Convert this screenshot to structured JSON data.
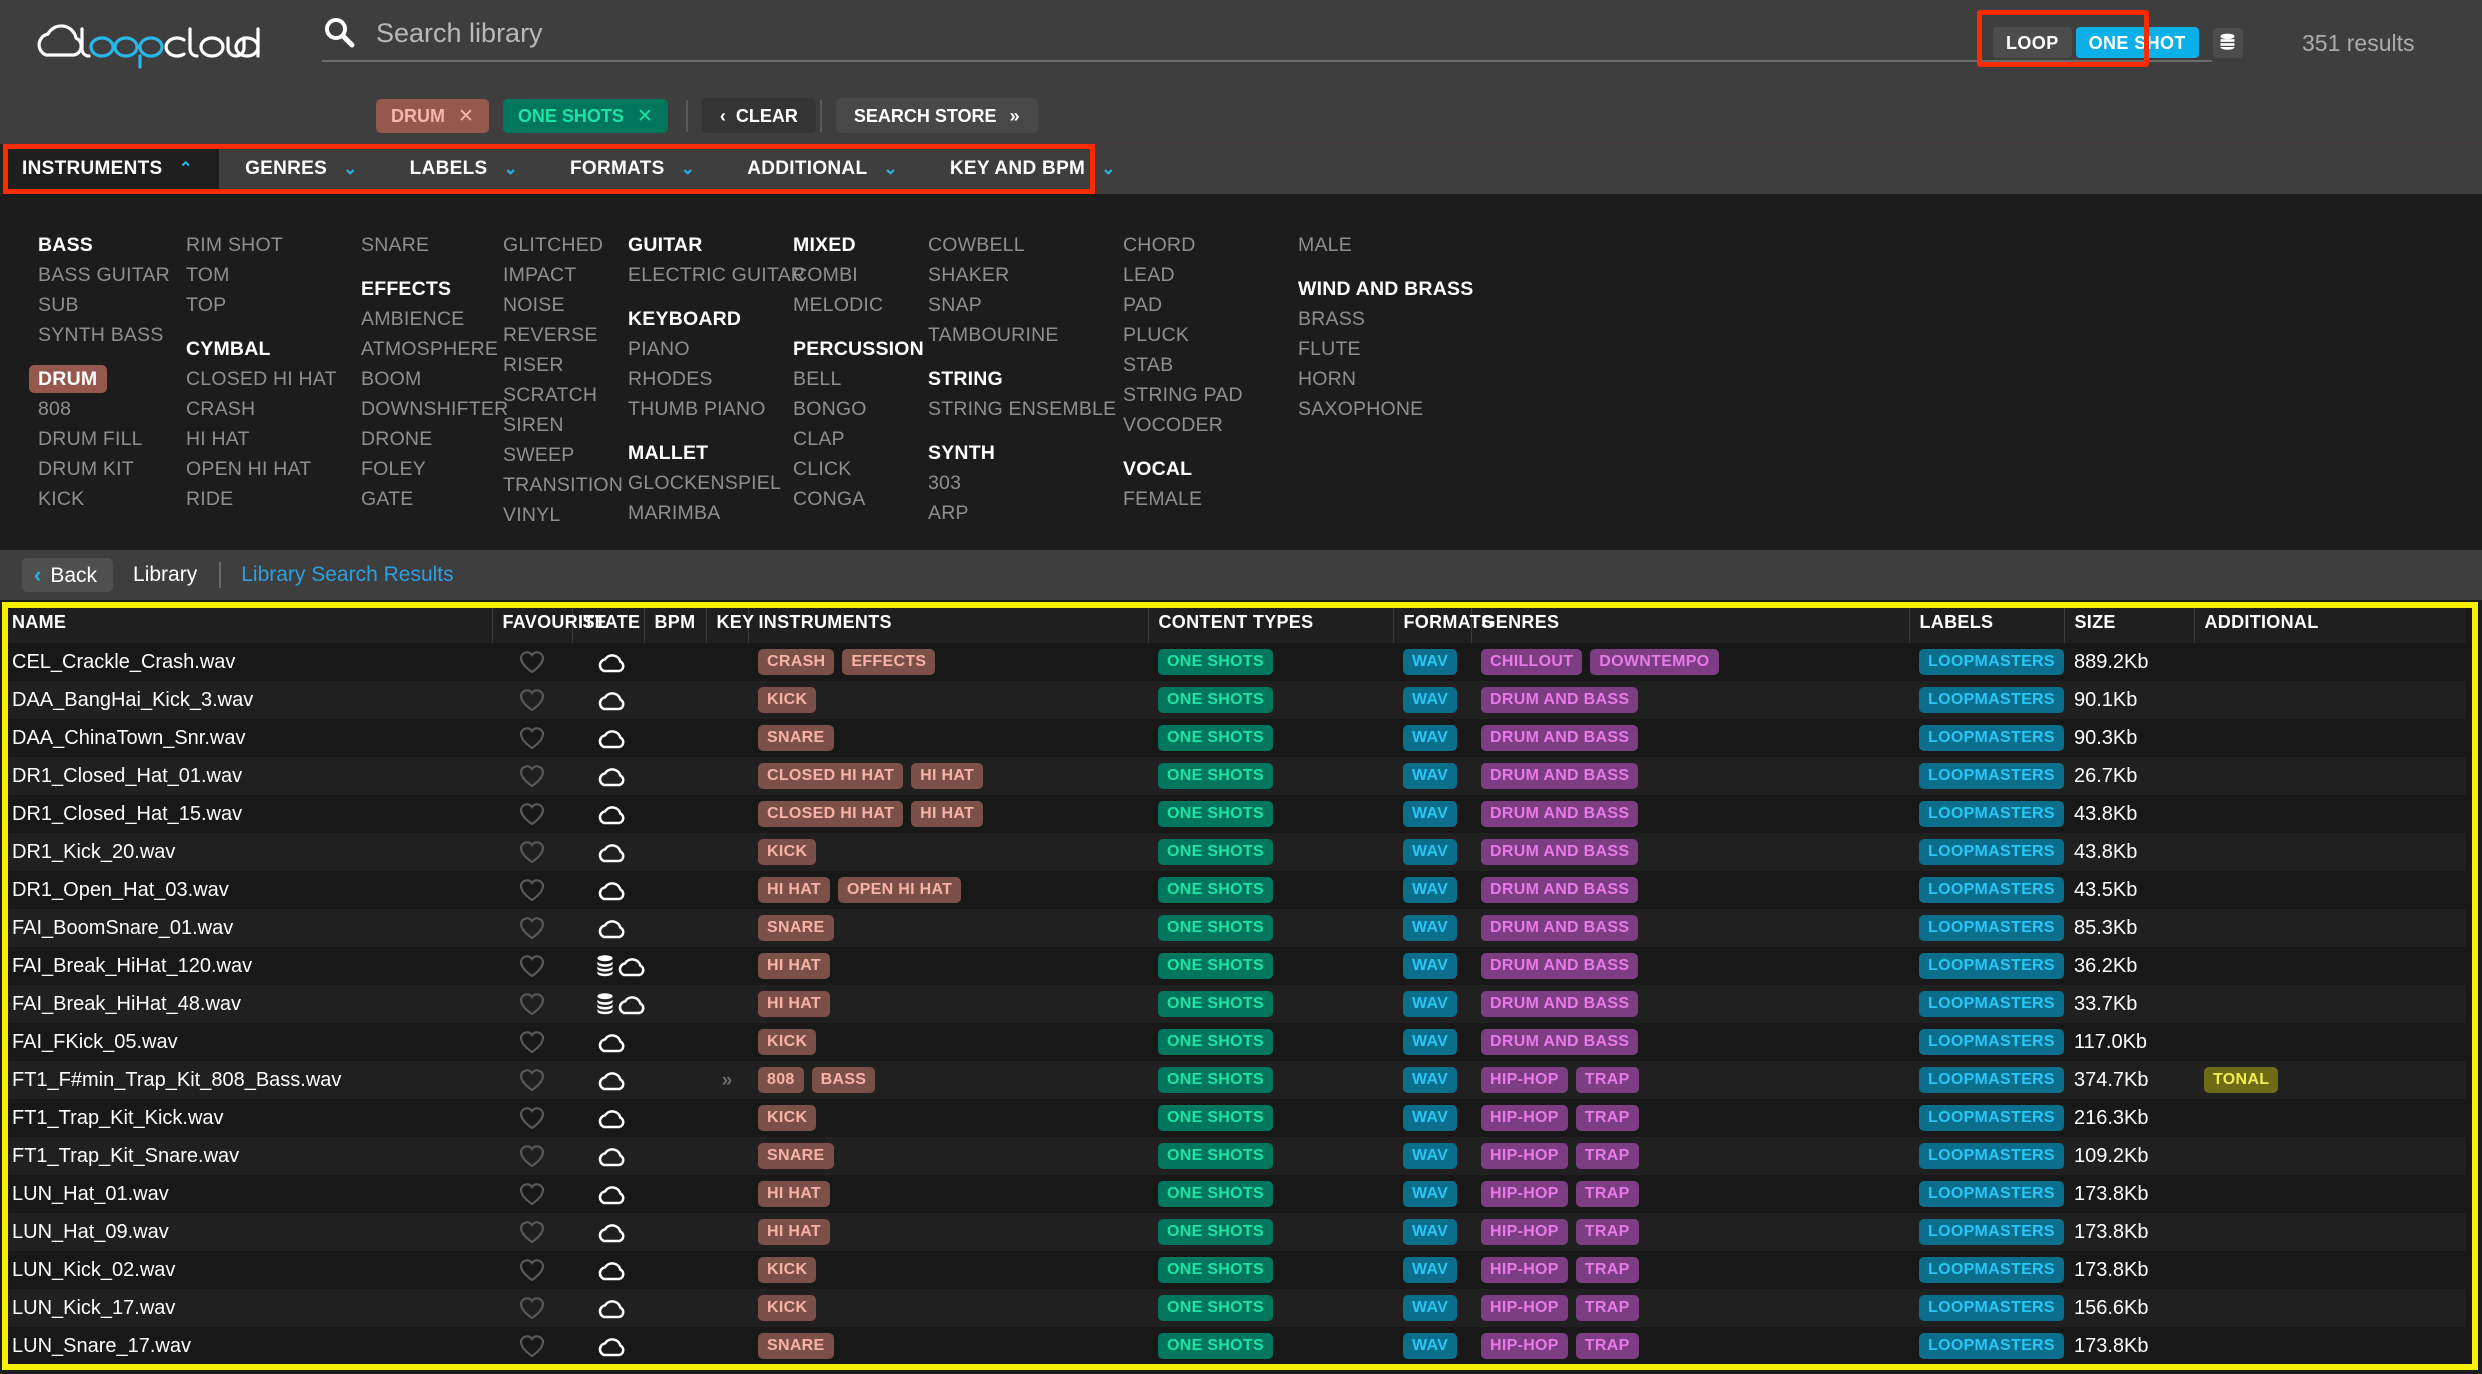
{
  "header": {
    "logo_text": "loopcloud",
    "search_placeholder": "Search library",
    "search_value": "",
    "mode_loop": "LOOP",
    "mode_oneshot": "ONE SHOT",
    "results_count": "351 results",
    "accent_blue": "#0cb0e8",
    "highlight_red": "#ff2b00",
    "highlight_yellow": "#f7f000"
  },
  "active_filters": [
    {
      "label": "DRUM",
      "close": "✕",
      "kind": "drum"
    },
    {
      "label": "ONE SHOTS",
      "close": "✕",
      "kind": "oneshots"
    }
  ],
  "filter_actions": {
    "clear_label": "CLEAR",
    "clear_icon": "‹",
    "search_store_label": "SEARCH STORE",
    "search_store_icon": "»"
  },
  "facet_tabs": [
    {
      "label": "INSTRUMENTS",
      "caret": "⌃",
      "active": true
    },
    {
      "label": "GENRES",
      "caret": "⌄",
      "active": false
    },
    {
      "label": "LABELS",
      "caret": "⌄",
      "active": false
    },
    {
      "label": "FORMATS",
      "caret": "⌄",
      "active": false
    },
    {
      "label": "ADDITIONAL",
      "caret": "⌄",
      "active": false
    },
    {
      "label": "KEY AND BPM",
      "caret": "⌄",
      "active": false
    }
  ],
  "facet_columns": [
    {
      "items": [
        {
          "text": "BASS",
          "type": "head"
        },
        {
          "text": "BASS GUITAR",
          "type": "item"
        },
        {
          "text": "SUB",
          "type": "item"
        },
        {
          "text": "SYNTH BASS",
          "type": "item"
        },
        {
          "text": "",
          "type": "spacer"
        },
        {
          "text": "DRUM",
          "type": "selected"
        },
        {
          "text": "808",
          "type": "item"
        },
        {
          "text": "DRUM FILL",
          "type": "item"
        },
        {
          "text": "DRUM KIT",
          "type": "item"
        },
        {
          "text": "KICK",
          "type": "item"
        }
      ]
    },
    {
      "items": [
        {
          "text": "RIM SHOT",
          "type": "item"
        },
        {
          "text": "TOM",
          "type": "item"
        },
        {
          "text": "TOP",
          "type": "item"
        },
        {
          "text": "",
          "type": "spacer"
        },
        {
          "text": "CYMBAL",
          "type": "head"
        },
        {
          "text": "CLOSED HI HAT",
          "type": "item"
        },
        {
          "text": "CRASH",
          "type": "item"
        },
        {
          "text": "HI HAT",
          "type": "item"
        },
        {
          "text": "OPEN HI HAT",
          "type": "item"
        },
        {
          "text": "RIDE",
          "type": "item"
        }
      ]
    },
    {
      "items": [
        {
          "text": "SNARE",
          "type": "item"
        },
        {
          "text": "",
          "type": "spacer"
        },
        {
          "text": "EFFECTS",
          "type": "head"
        },
        {
          "text": "AMBIENCE",
          "type": "item"
        },
        {
          "text": "ATMOSPHERE",
          "type": "item"
        },
        {
          "text": "BOOM",
          "type": "item"
        },
        {
          "text": "DOWNSHIFTER",
          "type": "item"
        },
        {
          "text": "DRONE",
          "type": "item"
        },
        {
          "text": "FOLEY",
          "type": "item"
        },
        {
          "text": "GATE",
          "type": "item"
        }
      ]
    },
    {
      "items": [
        {
          "text": "GLITCHED",
          "type": "item"
        },
        {
          "text": "IMPACT",
          "type": "item"
        },
        {
          "text": "NOISE",
          "type": "item"
        },
        {
          "text": "REVERSE",
          "type": "item"
        },
        {
          "text": "RISER",
          "type": "item"
        },
        {
          "text": "SCRATCH",
          "type": "item"
        },
        {
          "text": "SIREN",
          "type": "item"
        },
        {
          "text": "SWEEP",
          "type": "item"
        },
        {
          "text": "TRANSITION",
          "type": "item"
        },
        {
          "text": "VINYL",
          "type": "item"
        }
      ]
    },
    {
      "items": [
        {
          "text": "GUITAR",
          "type": "head"
        },
        {
          "text": "ELECTRIC GUITAR",
          "type": "item"
        },
        {
          "text": "",
          "type": "spacer"
        },
        {
          "text": "KEYBOARD",
          "type": "head"
        },
        {
          "text": "PIANO",
          "type": "item"
        },
        {
          "text": "RHODES",
          "type": "item"
        },
        {
          "text": "THUMB PIANO",
          "type": "item"
        },
        {
          "text": "",
          "type": "spacer"
        },
        {
          "text": "MALLET",
          "type": "head"
        },
        {
          "text": "GLOCKENSPIEL",
          "type": "item"
        },
        {
          "text": "MARIMBA",
          "type": "item"
        }
      ]
    },
    {
      "items": [
        {
          "text": "MIXED",
          "type": "head"
        },
        {
          "text": "COMBI",
          "type": "item"
        },
        {
          "text": "MELODIC",
          "type": "item"
        },
        {
          "text": "",
          "type": "spacer"
        },
        {
          "text": "PERCUSSION",
          "type": "head"
        },
        {
          "text": "BELL",
          "type": "item"
        },
        {
          "text": "BONGO",
          "type": "item"
        },
        {
          "text": "CLAP",
          "type": "item"
        },
        {
          "text": "CLICK",
          "type": "item"
        },
        {
          "text": "CONGA",
          "type": "item"
        }
      ]
    },
    {
      "items": [
        {
          "text": "COWBELL",
          "type": "item"
        },
        {
          "text": "SHAKER",
          "type": "item"
        },
        {
          "text": "SNAP",
          "type": "item"
        },
        {
          "text": "TAMBOURINE",
          "type": "item"
        },
        {
          "text": "",
          "type": "spacer"
        },
        {
          "text": "STRING",
          "type": "head"
        },
        {
          "text": "STRING ENSEMBLE",
          "type": "item"
        },
        {
          "text": "",
          "type": "spacer"
        },
        {
          "text": "SYNTH",
          "type": "head"
        },
        {
          "text": "303",
          "type": "item"
        },
        {
          "text": "ARP",
          "type": "item"
        }
      ]
    },
    {
      "items": [
        {
          "text": "CHORD",
          "type": "item"
        },
        {
          "text": "LEAD",
          "type": "item"
        },
        {
          "text": "PAD",
          "type": "item"
        },
        {
          "text": "PLUCK",
          "type": "item"
        },
        {
          "text": "STAB",
          "type": "item"
        },
        {
          "text": "STRING PAD",
          "type": "item"
        },
        {
          "text": "VOCODER",
          "type": "item"
        },
        {
          "text": "",
          "type": "spacer"
        },
        {
          "text": "VOCAL",
          "type": "head"
        },
        {
          "text": "FEMALE",
          "type": "item"
        }
      ]
    },
    {
      "items": [
        {
          "text": "MALE",
          "type": "item"
        },
        {
          "text": "",
          "type": "spacer"
        },
        {
          "text": "WIND AND BRASS",
          "type": "head"
        },
        {
          "text": "BRASS",
          "type": "item"
        },
        {
          "text": "FLUTE",
          "type": "item"
        },
        {
          "text": "HORN",
          "type": "item"
        },
        {
          "text": "SAXOPHONE",
          "type": "item"
        }
      ]
    }
  ],
  "breadcrumb": {
    "back_label": "Back",
    "back_icon": "‹",
    "library_label": "Library",
    "current_label": "Library Search Results"
  },
  "table": {
    "columns": [
      "NAME",
      "FAVOURITE",
      "STATE",
      "BPM",
      "KEY",
      "INSTRUMENTS",
      "CONTENT TYPES",
      "FORMATS",
      "GENRES",
      "LABELS",
      "SIZE",
      "ADDITIONAL"
    ],
    "rows": [
      {
        "name": "CEL_Crackle_Crash.wav",
        "favourite": false,
        "stacked": false,
        "cloud": true,
        "bpm": "",
        "key": "",
        "instruments": [
          "CRASH",
          "EFFECTS"
        ],
        "content_types": [
          "ONE SHOTS"
        ],
        "formats": [
          "WAV"
        ],
        "genres": [
          "CHILLOUT",
          "DOWNTEMPO"
        ],
        "labels": [
          "LOOPMASTERS"
        ],
        "size": "889.2Kb",
        "additional": []
      },
      {
        "name": "DAA_BangHai_Kick_3.wav",
        "favourite": false,
        "stacked": false,
        "cloud": true,
        "bpm": "",
        "key": "",
        "instruments": [
          "KICK"
        ],
        "content_types": [
          "ONE SHOTS"
        ],
        "formats": [
          "WAV"
        ],
        "genres": [
          "DRUM AND BASS"
        ],
        "labels": [
          "LOOPMASTERS"
        ],
        "size": "90.1Kb",
        "additional": []
      },
      {
        "name": "DAA_ChinaTown_Snr.wav",
        "favourite": false,
        "stacked": false,
        "cloud": true,
        "bpm": "",
        "key": "",
        "instruments": [
          "SNARE"
        ],
        "content_types": [
          "ONE SHOTS"
        ],
        "formats": [
          "WAV"
        ],
        "genres": [
          "DRUM AND BASS"
        ],
        "labels": [
          "LOOPMASTERS"
        ],
        "size": "90.3Kb",
        "additional": []
      },
      {
        "name": "DR1_Closed_Hat_01.wav",
        "favourite": false,
        "stacked": false,
        "cloud": true,
        "bpm": "",
        "key": "",
        "instruments": [
          "CLOSED HI HAT",
          "HI HAT"
        ],
        "content_types": [
          "ONE SHOTS"
        ],
        "formats": [
          "WAV"
        ],
        "genres": [
          "DRUM AND BASS"
        ],
        "labels": [
          "LOOPMASTERS"
        ],
        "size": "26.7Kb",
        "additional": []
      },
      {
        "name": "DR1_Closed_Hat_15.wav",
        "favourite": false,
        "stacked": false,
        "cloud": true,
        "bpm": "",
        "key": "",
        "instruments": [
          "CLOSED HI HAT",
          "HI HAT"
        ],
        "content_types": [
          "ONE SHOTS"
        ],
        "formats": [
          "WAV"
        ],
        "genres": [
          "DRUM AND BASS"
        ],
        "labels": [
          "LOOPMASTERS"
        ],
        "size": "43.8Kb",
        "additional": []
      },
      {
        "name": "DR1_Kick_20.wav",
        "favourite": false,
        "stacked": false,
        "cloud": true,
        "bpm": "",
        "key": "",
        "instruments": [
          "KICK"
        ],
        "content_types": [
          "ONE SHOTS"
        ],
        "formats": [
          "WAV"
        ],
        "genres": [
          "DRUM AND BASS"
        ],
        "labels": [
          "LOOPMASTERS"
        ],
        "size": "43.8Kb",
        "additional": []
      },
      {
        "name": "DR1_Open_Hat_03.wav",
        "favourite": false,
        "stacked": false,
        "cloud": true,
        "bpm": "",
        "key": "",
        "instruments": [
          "HI HAT",
          "OPEN HI HAT"
        ],
        "content_types": [
          "ONE SHOTS"
        ],
        "formats": [
          "WAV"
        ],
        "genres": [
          "DRUM AND BASS"
        ],
        "labels": [
          "LOOPMASTERS"
        ],
        "size": "43.5Kb",
        "additional": []
      },
      {
        "name": "FAI_BoomSnare_01.wav",
        "favourite": false,
        "stacked": false,
        "cloud": true,
        "bpm": "",
        "key": "",
        "instruments": [
          "SNARE"
        ],
        "content_types": [
          "ONE SHOTS"
        ],
        "formats": [
          "WAV"
        ],
        "genres": [
          "DRUM AND BASS"
        ],
        "labels": [
          "LOOPMASTERS"
        ],
        "size": "85.3Kb",
        "additional": []
      },
      {
        "name": "FAI_Break_HiHat_120.wav",
        "favourite": false,
        "stacked": true,
        "cloud": true,
        "bpm": "",
        "key": "",
        "instruments": [
          "HI HAT"
        ],
        "content_types": [
          "ONE SHOTS"
        ],
        "formats": [
          "WAV"
        ],
        "genres": [
          "DRUM AND BASS"
        ],
        "labels": [
          "LOOPMASTERS"
        ],
        "size": "36.2Kb",
        "additional": []
      },
      {
        "name": "FAI_Break_HiHat_48.wav",
        "favourite": false,
        "stacked": true,
        "cloud": true,
        "bpm": "",
        "key": "",
        "instruments": [
          "HI HAT"
        ],
        "content_types": [
          "ONE SHOTS"
        ],
        "formats": [
          "WAV"
        ],
        "genres": [
          "DRUM AND BASS"
        ],
        "labels": [
          "LOOPMASTERS"
        ],
        "size": "33.7Kb",
        "additional": []
      },
      {
        "name": "FAI_FKick_05.wav",
        "favourite": false,
        "stacked": false,
        "cloud": true,
        "bpm": "",
        "key": "",
        "instruments": [
          "KICK"
        ],
        "content_types": [
          "ONE SHOTS"
        ],
        "formats": [
          "WAV"
        ],
        "genres": [
          "DRUM AND BASS"
        ],
        "labels": [
          "LOOPMASTERS"
        ],
        "size": "117.0Kb",
        "additional": []
      },
      {
        "name": "FT1_F#min_Trap_Kit_808_Bass.wav",
        "favourite": false,
        "stacked": false,
        "cloud": true,
        "bpm": "",
        "key": "»",
        "instruments": [
          "808",
          "BASS"
        ],
        "content_types": [
          "ONE SHOTS"
        ],
        "formats": [
          "WAV"
        ],
        "genres": [
          "HIP-HOP",
          "TRAP"
        ],
        "labels": [
          "LOOPMASTERS"
        ],
        "size": "374.7Kb",
        "additional": [
          "TONAL"
        ]
      },
      {
        "name": "FT1_Trap_Kit_Kick.wav",
        "favourite": false,
        "stacked": false,
        "cloud": true,
        "bpm": "",
        "key": "",
        "instruments": [
          "KICK"
        ],
        "content_types": [
          "ONE SHOTS"
        ],
        "formats": [
          "WAV"
        ],
        "genres": [
          "HIP-HOP",
          "TRAP"
        ],
        "labels": [
          "LOOPMASTERS"
        ],
        "size": "216.3Kb",
        "additional": []
      },
      {
        "name": "FT1_Trap_Kit_Snare.wav",
        "favourite": false,
        "stacked": false,
        "cloud": true,
        "bpm": "",
        "key": "",
        "instruments": [
          "SNARE"
        ],
        "content_types": [
          "ONE SHOTS"
        ],
        "formats": [
          "WAV"
        ],
        "genres": [
          "HIP-HOP",
          "TRAP"
        ],
        "labels": [
          "LOOPMASTERS"
        ],
        "size": "109.2Kb",
        "additional": []
      },
      {
        "name": "LUN_Hat_01.wav",
        "favourite": false,
        "stacked": false,
        "cloud": true,
        "bpm": "",
        "key": "",
        "instruments": [
          "HI HAT"
        ],
        "content_types": [
          "ONE SHOTS"
        ],
        "formats": [
          "WAV"
        ],
        "genres": [
          "HIP-HOP",
          "TRAP"
        ],
        "labels": [
          "LOOPMASTERS"
        ],
        "size": "173.8Kb",
        "additional": []
      },
      {
        "name": "LUN_Hat_09.wav",
        "favourite": false,
        "stacked": false,
        "cloud": true,
        "bpm": "",
        "key": "",
        "instruments": [
          "HI HAT"
        ],
        "content_types": [
          "ONE SHOTS"
        ],
        "formats": [
          "WAV"
        ],
        "genres": [
          "HIP-HOP",
          "TRAP"
        ],
        "labels": [
          "LOOPMASTERS"
        ],
        "size": "173.8Kb",
        "additional": []
      },
      {
        "name": "LUN_Kick_02.wav",
        "favourite": false,
        "stacked": false,
        "cloud": true,
        "bpm": "",
        "key": "",
        "instruments": [
          "KICK"
        ],
        "content_types": [
          "ONE SHOTS"
        ],
        "formats": [
          "WAV"
        ],
        "genres": [
          "HIP-HOP",
          "TRAP"
        ],
        "labels": [
          "LOOPMASTERS"
        ],
        "size": "173.8Kb",
        "additional": []
      },
      {
        "name": "LUN_Kick_17.wav",
        "favourite": false,
        "stacked": false,
        "cloud": true,
        "bpm": "",
        "key": "",
        "instruments": [
          "KICK"
        ],
        "content_types": [
          "ONE SHOTS"
        ],
        "formats": [
          "WAV"
        ],
        "genres": [
          "HIP-HOP",
          "TRAP"
        ],
        "labels": [
          "LOOPMASTERS"
        ],
        "size": "156.6Kb",
        "additional": []
      },
      {
        "name": "LUN_Snare_17.wav",
        "favourite": false,
        "stacked": false,
        "cloud": true,
        "bpm": "",
        "key": "",
        "instruments": [
          "SNARE"
        ],
        "content_types": [
          "ONE SHOTS"
        ],
        "formats": [
          "WAV"
        ],
        "genres": [
          "HIP-HOP",
          "TRAP"
        ],
        "labels": [
          "LOOPMASTERS"
        ],
        "size": "173.8Kb",
        "additional": []
      }
    ]
  }
}
